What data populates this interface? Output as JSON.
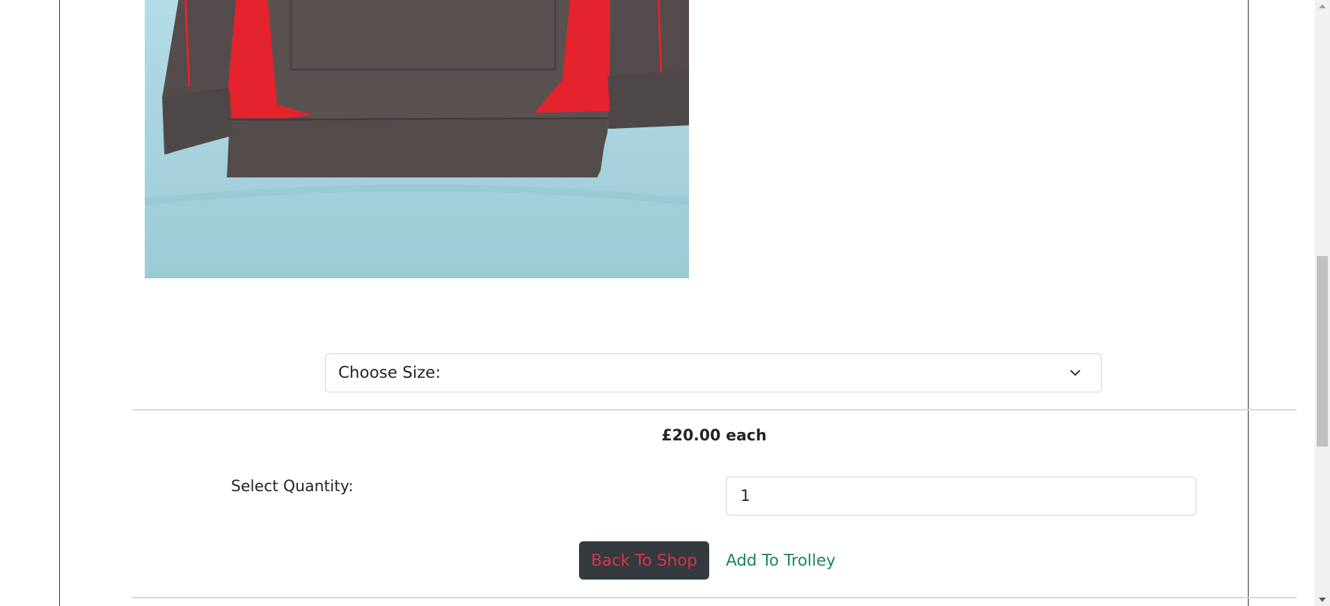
{
  "product": {
    "image_alt": "Grey and red hoodie laid on a light blue background",
    "size_select": {
      "placeholder": "Choose Size:",
      "icon": "chevron-down-icon"
    },
    "price_text": "£20.00 each",
    "quantity": {
      "label": "Select Quantity:",
      "value": "1"
    },
    "buttons": {
      "back_label": "Back To Shop",
      "add_label": "Add To Trolley"
    }
  },
  "colors": {
    "back_button_bg": "#343a40",
    "back_button_text": "#dc3545",
    "add_button_text": "#198754"
  }
}
